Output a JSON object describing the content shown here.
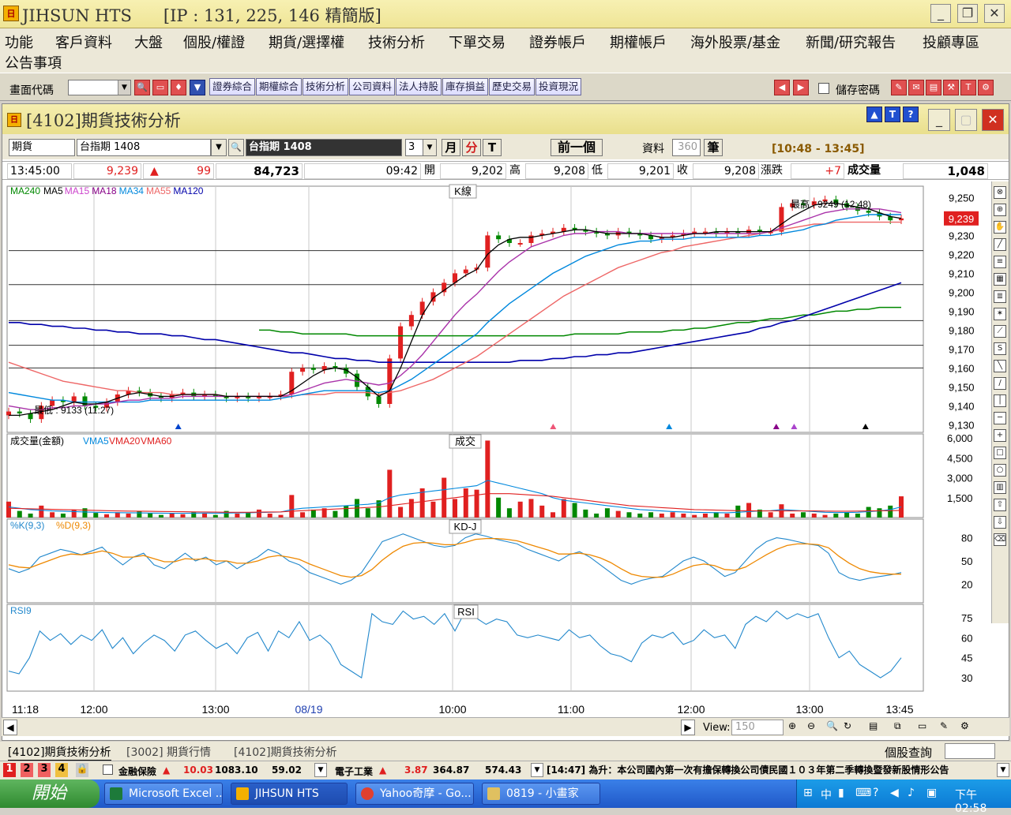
{
  "app": {
    "title": "JIHSUN HTS      [IP : 131, 225, 146 精簡版]",
    "logo_text": "日"
  },
  "menu": {
    "items": [
      "功能",
      "客戶資料",
      "大盤",
      "個股/權證",
      "期貨/選擇權",
      "技術分析",
      "下單交易",
      "證券帳戶",
      "期權帳戶",
      "海外股票/基金",
      "新聞/研究報告",
      "投顧專區"
    ],
    "second_row": "公告事項"
  },
  "toolbar": {
    "screen_code_label": "畫面代碼",
    "tabs": [
      "證券綜合",
      "期權綜合",
      "技術分析",
      "公司資料",
      "法人持股",
      "庫存損益",
      "歷史交易",
      "投資現況"
    ],
    "save_password_label": "儲存密碼"
  },
  "window": {
    "title": "[4102]期貨技術分析",
    "help": "?",
    "btn_a": "A",
    "btn_t": "T"
  },
  "query": {
    "market": "期貨",
    "product": "台指期 1408",
    "product_display": "台指期  1408",
    "interval": "3",
    "month": "月",
    "minute": "分",
    "t": "T",
    "prev": "前一個",
    "data_label": "資料",
    "data_count": "360",
    "unit": "筆",
    "range": "[10:48 - 13:45]"
  },
  "quote": {
    "time": "13:45:00",
    "price": "9,239",
    "change": "99",
    "total": "84,723",
    "time2": "09:42",
    "open_label": "開",
    "open": "9,202",
    "high_label": "高",
    "high": "9,208",
    "low_label": "低",
    "low": "9,201",
    "close_label": "收",
    "close": "9,208",
    "chg_label": "漲跌",
    "chg": "+7",
    "vol_label": "成交量",
    "vol": "1,048"
  },
  "chart_data": {
    "type": "line",
    "x_ticks": [
      "11:18",
      "12:00",
      "13:00",
      "08/19",
      "10:00",
      "11:00",
      "12:00",
      "13:00",
      "13:45"
    ],
    "price_panel": {
      "title": "K線",
      "ma_labels": [
        {
          "name": "MA240",
          "color": "#008800"
        },
        {
          "name": "MA5",
          "color": "#000000"
        },
        {
          "name": "MA15",
          "color": "#cc44cc"
        },
        {
          "name": "MA18",
          "color": "#880088"
        },
        {
          "name": "MA34",
          "color": "#0088dd"
        },
        {
          "name": "MA55",
          "color": "#ee6666"
        },
        {
          "name": "MA120",
          "color": "#0000aa"
        }
      ],
      "yticks": [
        9250,
        9240,
        9230,
        9220,
        9210,
        9200,
        9190,
        9180,
        9170,
        9160,
        9150,
        9140,
        9130
      ],
      "ylim": [
        9126,
        9256
      ],
      "current_price": "9,239",
      "high_note": "最高 : 9249 (12:48)",
      "low_note": "最低 : 9133 (11:27)",
      "close_series": [
        9137,
        9136,
        9133,
        9140,
        9143,
        9142,
        9145,
        9140,
        9139,
        9142,
        9146,
        9148,
        9147,
        9145,
        9144,
        9146,
        9147,
        9145,
        9146,
        9145,
        9144,
        9145,
        9144,
        9145,
        9145,
        9146,
        9158,
        9160,
        9159,
        9161,
        9160,
        9157,
        9150,
        9145,
        9141,
        9165,
        9182,
        9188,
        9195,
        9200,
        9205,
        9210,
        9212,
        9213,
        9230,
        9228,
        9226,
        9226,
        9230,
        9231,
        9232,
        9234,
        9233,
        9232,
        9231,
        9230,
        9232,
        9231,
        9230,
        9228,
        9229,
        9230,
        9231,
        9232,
        9232,
        9231,
        9232,
        9231,
        9233,
        9232,
        9232,
        9245,
        9247,
        9246,
        9248,
        9249,
        9247,
        9245,
        9243,
        9242,
        9240,
        9238,
        9239
      ],
      "ma5": [
        9135,
        9135,
        9136,
        9137,
        9138,
        9140,
        9142,
        9141,
        9141,
        9142,
        9144,
        9146,
        9147,
        9146,
        9145,
        9145,
        9146,
        9146,
        9146,
        9146,
        9145,
        9145,
        9145,
        9145,
        9145,
        9145,
        9148,
        9152,
        9156,
        9159,
        9160,
        9159,
        9155,
        9150,
        9145,
        9148,
        9160,
        9174,
        9188,
        9197,
        9201,
        9205,
        9209,
        9212,
        9220,
        9225,
        9228,
        9229,
        9229,
        9230,
        9231,
        9232,
        9233,
        9233,
        9232,
        9231,
        9231,
        9231,
        9231,
        9230,
        9229,
        9229,
        9230,
        9231,
        9231,
        9232,
        9232,
        9232,
        9232,
        9232,
        9232,
        9236,
        9240,
        9243,
        9246,
        9247,
        9247,
        9246,
        9245,
        9244,
        9242,
        9240,
        9239
      ],
      "ma240": [
        null,
        null,
        null,
        null,
        null,
        null,
        null,
        null,
        null,
        null,
        null,
        null,
        null,
        null,
        null,
        null,
        null,
        null,
        null,
        null,
        null,
        null,
        null,
        9180,
        9180,
        9179,
        9179,
        9178,
        9178,
        9178,
        9178,
        9178,
        9177,
        9177,
        9177,
        9177,
        9177,
        9177,
        9177,
        9177,
        9177,
        9177,
        9177,
        9177,
        9177,
        9177,
        9177,
        9177,
        9177,
        9177,
        9177,
        9177,
        9178,
        9178,
        9178,
        9178,
        9178,
        9179,
        9179,
        9179,
        9179,
        9180,
        9180,
        9181,
        9181,
        9182,
        9183,
        9184,
        9184,
        9185,
        9186,
        9186,
        9187,
        9188,
        9188,
        9189,
        9190,
        9190,
        9191,
        9191,
        9192,
        9192,
        9192
      ],
      "ma120": [
        9184,
        9184,
        9183,
        9183,
        9182,
        9182,
        9181,
        9181,
        9180,
        9180,
        9179,
        9179,
        9178,
        9178,
        9178,
        9177,
        9177,
        9176,
        9175,
        9175,
        9174,
        9173,
        9172,
        9171,
        9170,
        9169,
        9168,
        9168,
        9167,
        9166,
        9165,
        9165,
        9164,
        9164,
        9163,
        9163,
        9163,
        9163,
        9163,
        9163,
        9163,
        9163,
        9163,
        9163,
        9163,
        9163,
        9163,
        9164,
        9164,
        9164,
        9165,
        9165,
        9166,
        9166,
        9167,
        9167,
        9168,
        9168,
        9169,
        9170,
        9171,
        9172,
        9173,
        9174,
        9175,
        9176,
        9177,
        9178,
        9179,
        9181,
        9182,
        9184,
        9185,
        9187,
        9189,
        9191,
        9193,
        9195,
        9197,
        9199,
        9201,
        9203,
        9205
      ],
      "ma34": [
        9147,
        9146,
        9145,
        9144,
        9143,
        9143,
        9142,
        9142,
        9142,
        9142,
        9142,
        9142,
        9142,
        9143,
        9143,
        9143,
        9143,
        9143,
        9143,
        9143,
        9143,
        9143,
        9143,
        9143,
        9143,
        9144,
        9145,
        9146,
        9147,
        9148,
        9148,
        9148,
        9148,
        9148,
        9147,
        9148,
        9151,
        9154,
        9158,
        9162,
        9166,
        9170,
        9174,
        9178,
        9184,
        9189,
        9194,
        9198,
        9202,
        9206,
        9210,
        9213,
        9216,
        9219,
        9221,
        9223,
        9225,
        9226,
        9227,
        9227,
        9228,
        9228,
        9228,
        9229,
        9229,
        9229,
        9229,
        9229,
        9229,
        9230,
        9230,
        9231,
        9232,
        9233,
        9235,
        9236,
        9238,
        9239,
        9240,
        9241,
        9241,
        9241,
        9241
      ],
      "ma55": [
        9163,
        9161,
        9159,
        9157,
        9155,
        9153,
        9152,
        9151,
        9150,
        9149,
        9148,
        9148,
        9147,
        9147,
        9147,
        9146,
        9146,
        9146,
        9146,
        9146,
        9145,
        9145,
        9145,
        9145,
        9145,
        9145,
        9145,
        9146,
        9146,
        9146,
        9147,
        9147,
        9147,
        9147,
        9146,
        9147,
        9148,
        9150,
        9152,
        9154,
        9157,
        9160,
        9163,
        9166,
        9170,
        9174,
        9178,
        9182,
        9186,
        9190,
        9194,
        9198,
        9201,
        9204,
        9207,
        9210,
        9213,
        9215,
        9217,
        9219,
        9221,
        9222,
        9224,
        9225,
        9226,
        9227,
        9228,
        9229,
        9230,
        9231,
        9232,
        9233,
        9234,
        9235,
        9236,
        9236,
        9237,
        9237,
        9237,
        9237,
        9237,
        9237,
        9237
      ],
      "ma15": [
        9140,
        9139,
        9138,
        9138,
        9139,
        9139,
        9140,
        9140,
        9141,
        9141,
        9142,
        9143,
        9143,
        9144,
        9144,
        9144,
        9145,
        9145,
        9145,
        9145,
        9145,
        9145,
        9145,
        9145,
        9145,
        9145,
        9146,
        9148,
        9150,
        9152,
        9153,
        9154,
        9153,
        9152,
        9151,
        9152,
        9156,
        9161,
        9167,
        9174,
        9181,
        9188,
        9194,
        9199,
        9205,
        9211,
        9216,
        9220,
        9224,
        9226,
        9228,
        9230,
        9231,
        9231,
        9232,
        9232,
        9232,
        9231,
        9231,
        9231,
        9231,
        9231,
        9231,
        9231,
        9231,
        9231,
        9231,
        9231,
        9231,
        9231,
        9232,
        9234,
        9236,
        9238,
        9240,
        9242,
        9243,
        9244,
        9244,
        9244,
        9244,
        9243,
        9242
      ],
      "markers": [
        {
          "pos": 0.19,
          "color": "#0044cc"
        },
        {
          "pos": 0.61,
          "color": "#ee5577"
        },
        {
          "pos": 0.74,
          "color": "#0088dd"
        },
        {
          "pos": 0.86,
          "color": "#880088"
        },
        {
          "pos": 0.88,
          "color": "#aa44cc"
        },
        {
          "pos": 0.96,
          "color": "#000000"
        }
      ]
    },
    "volume_panel": {
      "title": "成交",
      "legend": [
        "成交量(金額)",
        "VMA5",
        "VMA20",
        "VMA60"
      ],
      "yticks": [
        6000,
        4500,
        3000,
        1500
      ],
      "ylim": [
        0,
        6300
      ],
      "values": [
        1200,
        500,
        300,
        900,
        400,
        300,
        600,
        700,
        350,
        250,
        400,
        300,
        500,
        350,
        200,
        300,
        250,
        400,
        300,
        200,
        500,
        300,
        400,
        600,
        300,
        200,
        1700,
        400,
        600,
        700,
        500,
        900,
        1400,
        700,
        1300,
        3600,
        800,
        1400,
        2200,
        1200,
        3000,
        1400,
        2200,
        2100,
        5800,
        1500,
        700,
        1200,
        1400,
        900,
        400,
        1400,
        1100,
        600,
        300,
        700,
        500,
        400,
        300,
        400,
        300,
        400,
        300,
        200,
        300,
        400,
        300,
        900,
        1100,
        600,
        400,
        1000,
        300,
        400,
        300,
        200,
        300,
        400,
        300,
        800,
        700,
        900,
        1600
      ],
      "vma5": [
        800,
        700,
        600,
        550,
        500,
        480,
        450,
        420,
        400,
        380,
        370,
        360,
        350,
        340,
        330,
        320,
        320,
        330,
        340,
        330,
        340,
        350,
        360,
        380,
        400,
        420,
        600,
        700,
        750,
        800,
        850,
        900,
        950,
        1000,
        1100,
        1500,
        1700,
        1800,
        1900,
        2000,
        2100,
        2200,
        2300,
        2400,
        2800,
        2600,
        2400,
        2200,
        2000,
        1800,
        1500,
        1300,
        1200,
        1100,
        1000,
        900,
        800,
        700,
        600,
        550,
        500,
        450,
        420,
        400,
        380,
        370,
        360,
        400,
        450,
        500,
        520,
        600,
        550,
        500,
        450,
        400,
        380,
        380,
        400,
        450,
        500,
        600,
        800
      ],
      "vma20": [
        700,
        680,
        660,
        640,
        620,
        600,
        580,
        560,
        540,
        520,
        500,
        490,
        480,
        470,
        460,
        450,
        440,
        430,
        420,
        410,
        400,
        400,
        400,
        410,
        420,
        430,
        480,
        520,
        560,
        600,
        640,
        680,
        720,
        760,
        800,
        900,
        1000,
        1100,
        1200,
        1300,
        1400,
        1500,
        1600,
        1700,
        1800,
        1800,
        1800,
        1750,
        1700,
        1650,
        1600,
        1500,
        1400,
        1300,
        1200,
        1100,
        1000,
        900,
        850,
        800,
        750,
        700,
        650,
        600,
        580,
        560,
        540,
        520,
        510,
        500,
        500,
        500,
        500,
        500,
        500,
        490,
        480,
        480,
        490,
        500,
        510,
        520,
        540
      ]
    },
    "kd_panel": {
      "title": "KD-J",
      "legend": [
        "%K(9,3)",
        "%D(9,3)"
      ],
      "yticks": [
        80,
        50,
        20
      ],
      "ylim": [
        0,
        100
      ],
      "k": [
        40,
        35,
        40,
        55,
        60,
        65,
        62,
        58,
        63,
        68,
        55,
        45,
        55,
        60,
        45,
        40,
        50,
        60,
        50,
        55,
        45,
        50,
        40,
        48,
        55,
        65,
        60,
        50,
        45,
        35,
        30,
        25,
        20,
        25,
        35,
        55,
        75,
        80,
        85,
        80,
        75,
        70,
        68,
        70,
        80,
        85,
        82,
        78,
        75,
        72,
        65,
        60,
        55,
        50,
        58,
        62,
        55,
        45,
        35,
        25,
        20,
        25,
        28,
        30,
        40,
        50,
        55,
        50,
        40,
        30,
        35,
        50,
        65,
        75,
        80,
        78,
        75,
        72,
        70,
        60,
        35,
        28,
        25,
        28,
        30,
        32,
        35
      ],
      "d": [
        45,
        42,
        41,
        46,
        51,
        56,
        59,
        58,
        60,
        63,
        60,
        55,
        55,
        57,
        53,
        49,
        49,
        53,
        52,
        53,
        50,
        50,
        47,
        47,
        50,
        55,
        57,
        55,
        52,
        46,
        41,
        36,
        31,
        29,
        31,
        39,
        51,
        61,
        69,
        73,
        74,
        73,
        71,
        71,
        74,
        78,
        79,
        79,
        78,
        76,
        72,
        68,
        64,
        59,
        59,
        60,
        58,
        54,
        48,
        40,
        33,
        30,
        29,
        29,
        33,
        39,
        44,
        46,
        44,
        39,
        38,
        42,
        50,
        58,
        65,
        70,
        72,
        72,
        71,
        67,
        56,
        47,
        40,
        36,
        34,
        33,
        33
      ]
    },
    "rsi_panel": {
      "title": "RSI",
      "legend": [
        "RSI9"
      ],
      "yticks": [
        75,
        60,
        45,
        30
      ],
      "ylim": [
        20,
        85
      ],
      "values": [
        35,
        33,
        45,
        65,
        58,
        63,
        55,
        62,
        58,
        66,
        52,
        60,
        48,
        56,
        62,
        58,
        50,
        62,
        65,
        58,
        52,
        56,
        48,
        60,
        64,
        50,
        65,
        60,
        72,
        58,
        62,
        55,
        40,
        35,
        30,
        78,
        72,
        70,
        80,
        74,
        76,
        70,
        78,
        65,
        80,
        75,
        70,
        74,
        72,
        62,
        60,
        62,
        60,
        58,
        66,
        60,
        62,
        54,
        48,
        46,
        42,
        56,
        62,
        60,
        64,
        55,
        58,
        66,
        60,
        62,
        52,
        70,
        76,
        72,
        80,
        74,
        78,
        75,
        78,
        60,
        45,
        50,
        40,
        35,
        30,
        35,
        45
      ]
    }
  },
  "bottom_tabs": {
    "tabs": [
      "[4102]期貨技術分析",
      "[3002] 期貨行情",
      "[4102]期貨技術分析"
    ],
    "stock_query_label": "個股查詢",
    "view_label": "View:",
    "view_value": "150"
  },
  "ticker": {
    "pages": [
      "1",
      "2",
      "3",
      "4"
    ],
    "item1_name": "金融保險",
    "item1_pct": "10.03",
    "item1_val": "1083.10",
    "item1_chg": "59.02",
    "item2_name": "電子工業",
    "item2_pct": "3.87",
    "item2_val": "364.87",
    "item2_chg": "574.43",
    "news": "[14:47]  為升：本公司國內第一次有擔保轉換公司債民國１０３年第二季轉換暨發新股情形公告"
  },
  "taskbar": {
    "start": "開始",
    "items": [
      "Microsoft Excel ...",
      "JIHSUN HTS",
      "Yahoo奇摩 - Go...",
      "0819 - 小畫家"
    ],
    "clock": "下午 02:58"
  }
}
